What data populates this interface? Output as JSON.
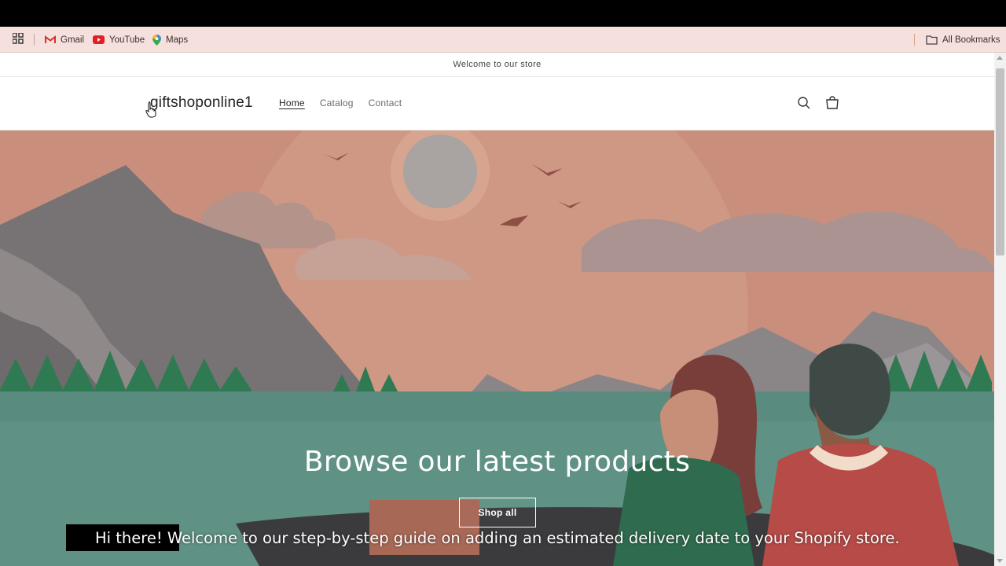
{
  "bookmarks": {
    "items": [
      {
        "label": "Gmail",
        "icon": "gmail-icon"
      },
      {
        "label": "YouTube",
        "icon": "youtube-icon"
      },
      {
        "label": "Maps",
        "icon": "maps-icon"
      }
    ],
    "all_bookmarks": "All Bookmarks"
  },
  "store": {
    "announcement": "Welcome to our store",
    "logo": "giftshoponline1",
    "nav": [
      "Home",
      "Catalog",
      "Contact"
    ],
    "active_nav": "Home"
  },
  "hero": {
    "title": "Browse our latest products",
    "button": "Shop all"
  },
  "caption": {
    "text": "Hi there! Welcome to our step-by-step guide on adding an estimated delivery date to your Shopify store."
  },
  "colors": {
    "bookmark_bar": "#f6e0dd",
    "sky": "#c98e7c",
    "water": "#5a8b7f",
    "trees": "#2f7a52"
  }
}
